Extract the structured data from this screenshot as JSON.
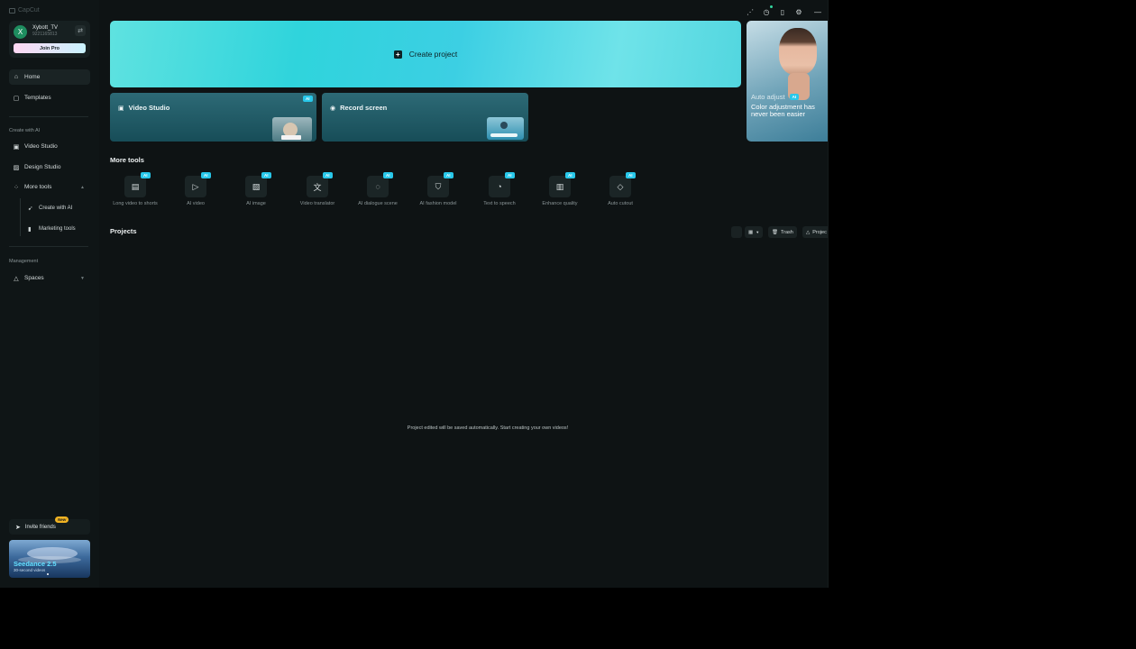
{
  "app": {
    "brand": "CapCut"
  },
  "account": {
    "avatar_letter": "X",
    "name": "Xybott_TV",
    "id": "9221165813",
    "join_pro": "Join Pro"
  },
  "nav": {
    "home": "Home",
    "templates": "Templates",
    "section_create": "Create with AI",
    "video_studio": "Video Studio",
    "design_studio": "Design Studio",
    "more_tools": "More tools",
    "create_with_ai": "Create with AI",
    "marketing_tools": "Marketing tools",
    "section_management": "Management",
    "spaces": "Spaces"
  },
  "invite": {
    "label": "Invite friends",
    "badge": "New"
  },
  "promo": {
    "title": "Seedance 2.5",
    "subtitle": "30-second videos"
  },
  "main": {
    "create_project": "Create project",
    "cards": [
      {
        "title": "Video Studio",
        "badge": "AI"
      },
      {
        "title": "Record screen"
      }
    ],
    "hero": {
      "line1": "Auto adjust",
      "badge": "AI",
      "line2": "Color adjustment has never been easier"
    },
    "more_tools_title": "More tools",
    "tools": [
      {
        "label": "Long video to shorts",
        "badge": "AI",
        "icon": "film-icon"
      },
      {
        "label": "AI video",
        "badge": "AI",
        "icon": "video-play-icon"
      },
      {
        "label": "AI image",
        "badge": "AI",
        "icon": "image-icon"
      },
      {
        "label": "Video translator",
        "badge": "AI",
        "icon": "translate-icon"
      },
      {
        "label": "AI dialogue scene",
        "badge": "AI",
        "icon": "dialogue-icon"
      },
      {
        "label": "AI fashion model",
        "badge": "AI",
        "icon": "shirt-icon"
      },
      {
        "label": "Text to speech",
        "badge": "AI",
        "icon": "speech-icon"
      },
      {
        "label": "Enhance quality",
        "badge": "AI",
        "icon": "enhance-icon"
      },
      {
        "label": "Auto cutout",
        "badge": "AI",
        "icon": "eraser-icon"
      }
    ],
    "projects_title": "Projects",
    "trash": "Trash",
    "project_btn": "Projec",
    "empty_message": "Project edited will be saved automatically. Start creating your own videos!"
  }
}
